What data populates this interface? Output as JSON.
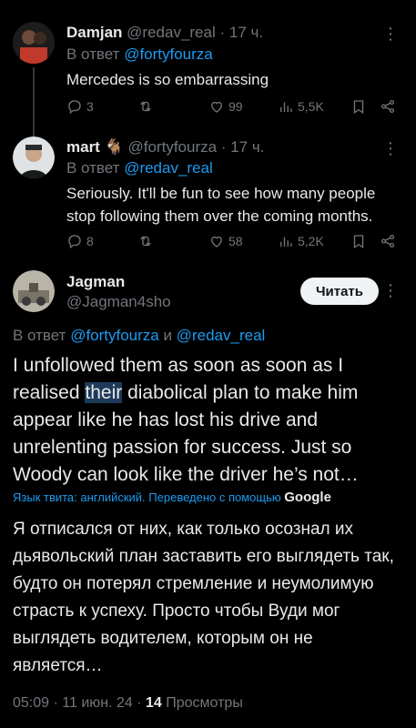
{
  "replies": [
    {
      "name": "Damjan",
      "handle": "@redav_real",
      "time": "· 17 ч.",
      "reply_prefix": "В ответ",
      "reply_to": "@fortyfourza",
      "text": "Mercedes is so embarrassing",
      "stats": {
        "replies": "3",
        "reposts": "",
        "likes": "99",
        "views": "5,5K"
      }
    },
    {
      "name": "mart",
      "name_emoji": "🐐",
      "handle": "@fortyfourza",
      "time": "· 17 ч.",
      "reply_prefix": "В ответ",
      "reply_to": "@redav_real",
      "text": "Seriously. It'll be fun to see how many people stop following them over the coming months.",
      "stats": {
        "replies": "8",
        "reposts": "",
        "likes": "58",
        "views": "5,2K"
      }
    }
  ],
  "main": {
    "name": "Jagman",
    "handle": "@Jagman4sho",
    "follow_label": "Читать",
    "reply_prefix": "В ответ",
    "reply_to_1": "@fortyfourza",
    "reply_and": "и",
    "reply_to_2": "@redav_real",
    "text_before": "I unfollowed them as soon as soon as I realised ",
    "text_highlight": "their",
    "text_after": " diabolical plan to make him appear like he has lost his drive and unrelenting passion for success. Just so Woody can look like the driver he’s not…",
    "translate_note": "Язык твита: английский. Переведено с помощью",
    "translate_brand": "Google",
    "translated_text": "Я отписался от них, как только осознал их дьявольский план заставить его выглядеть так, будто он потерял стремление и неумолимую страсть к успеху. Просто чтобы Вуди мог выглядеть водителем, которым он не является…",
    "time": "05:09 · 11 июн. 24 ·",
    "views_count": "14",
    "views_label": "Просмотры"
  },
  "icons": [
    "reply-icon",
    "repost-icon",
    "like-icon",
    "views-icon",
    "bookmark-icon",
    "share-icon",
    "more-icon"
  ]
}
